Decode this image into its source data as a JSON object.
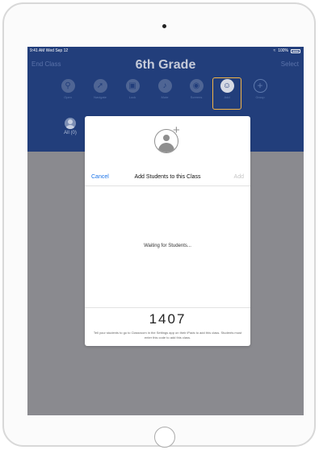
{
  "status_bar": {
    "time": "9:41 AM  Wed Sep 12",
    "battery": "100%"
  },
  "header": {
    "left_label": "End Class",
    "title": "6th Grade",
    "right_label": "Select"
  },
  "toolbar": {
    "items": [
      {
        "label": "Open",
        "icon": "open-icon"
      },
      {
        "label": "Navigate",
        "icon": "compass-icon"
      },
      {
        "label": "Lock",
        "icon": "lock-icon"
      },
      {
        "label": "Mute",
        "icon": "mute-icon"
      },
      {
        "label": "Screens",
        "icon": "screens-icon"
      },
      {
        "label": "Add",
        "icon": "add-student-icon",
        "selected": true
      },
      {
        "label": "Group",
        "icon": "plus-icon"
      }
    ]
  },
  "groups": {
    "all_label": "All (0)"
  },
  "modal": {
    "cancel_label": "Cancel",
    "title": "Add Students to this Class",
    "add_label": "Add",
    "waiting_text": "Waiting for Students...",
    "class_code": "1407",
    "instructions": "Tell your students to go to Classroom in the Settings app on their iPads to add this class. Students must enter this code to add this class."
  },
  "colors": {
    "header_bg": "#223e7b",
    "accent_link": "#1a73e8",
    "highlight": "#f3b447",
    "dim_background": "#8a8a8f"
  }
}
